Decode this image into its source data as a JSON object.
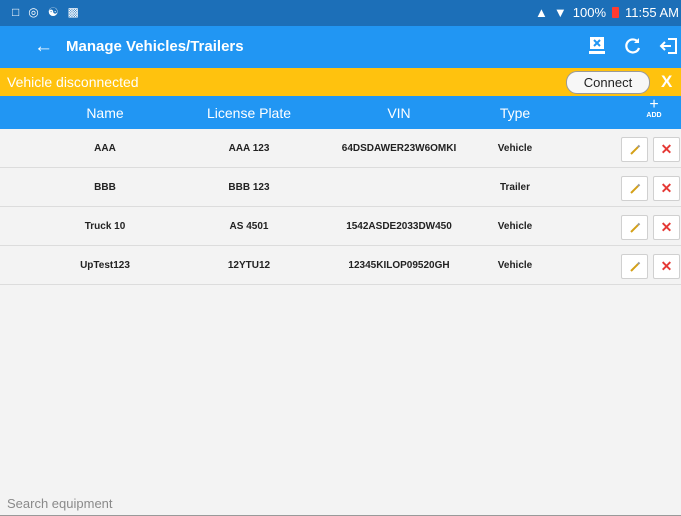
{
  "status_bar": {
    "left_icons": [
      "notification-icon",
      "location-icon",
      "bluetooth-icon",
      "image-icon"
    ],
    "battery": "100%",
    "time": "11:55 AM"
  },
  "app_bar": {
    "title": "Manage Vehicles/Trailers",
    "actions": [
      "device-disconnect-icon",
      "refresh-icon",
      "logout-icon"
    ]
  },
  "banner": {
    "text": "Vehicle disconnected",
    "connect_label": "Connect",
    "close_label": "X",
    "color": "#ffc20e"
  },
  "table": {
    "headers": [
      "Name",
      "License Plate",
      "VIN",
      "Type"
    ],
    "add_label": "ADD",
    "rows": [
      {
        "name": "AAA",
        "plate": "AAA 123",
        "vin": "64DSDAWER23W6OMKI",
        "type": "Vehicle"
      },
      {
        "name": "BBB",
        "plate": "BBB 123",
        "vin": "",
        "type": "Trailer"
      },
      {
        "name": "Truck 10",
        "plate": "AS 4501",
        "vin": "1542ASDE2033DW450",
        "type": "Vehicle"
      },
      {
        "name": "UpTest123",
        "plate": "12YTU12",
        "vin": "12345KILOP09520GH",
        "type": "Vehicle"
      }
    ]
  },
  "search": {
    "placeholder": "Search equipment",
    "value": ""
  },
  "colors": {
    "status_bar": "#1c6fb8",
    "primary": "#2196f3",
    "delete": "#e53935"
  }
}
